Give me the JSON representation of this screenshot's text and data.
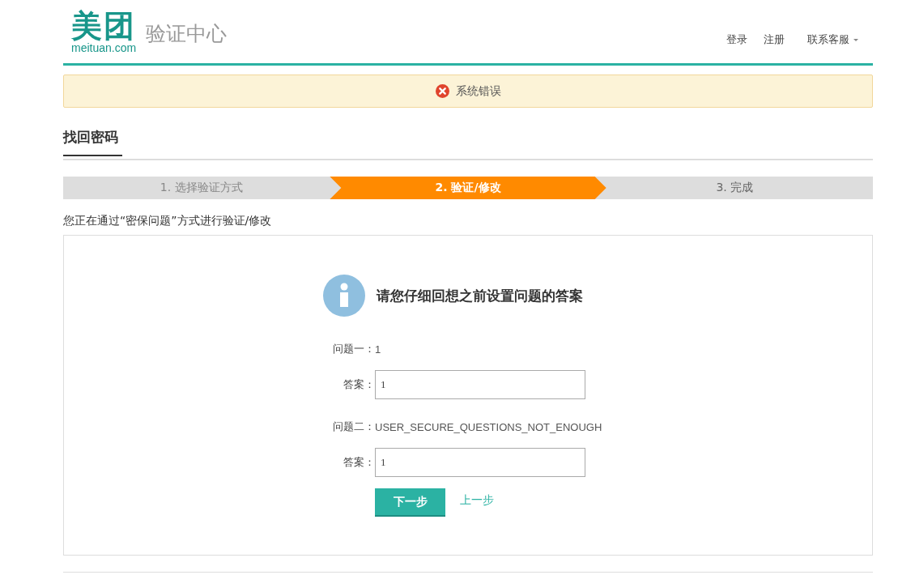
{
  "header": {
    "logo_mark": "美团",
    "logo_domain": "meituan.com",
    "site_title": "验证中心",
    "nav": [
      {
        "label": "登录",
        "kind": "link"
      },
      {
        "label": "注册",
        "kind": "link"
      },
      {
        "label": "联系客服",
        "kind": "dropdown"
      }
    ]
  },
  "alert": {
    "message": "系统错误"
  },
  "page_title": "找回密码",
  "steps": [
    {
      "label": "1. 选择验证方式",
      "selected": false
    },
    {
      "label": "2. 验证/修改",
      "selected": true
    },
    {
      "label": "3. 完成",
      "selected": false
    }
  ],
  "notice": "您正在通过“密保问题”方式进行验证/修改",
  "form": {
    "heading": "请您仔细回想之前设置问题的答案",
    "questions": [
      {
        "label": "问题一：",
        "question": "1",
        "answer_label": "答案：",
        "answer": "1"
      },
      {
        "label": "问题二：",
        "question": "USER_SECURE_QUESTIONS_NOT_ENOUGH",
        "answer_label": "答案：",
        "answer": "1"
      }
    ],
    "next_button": "下一步",
    "back_link": "上一步"
  }
}
